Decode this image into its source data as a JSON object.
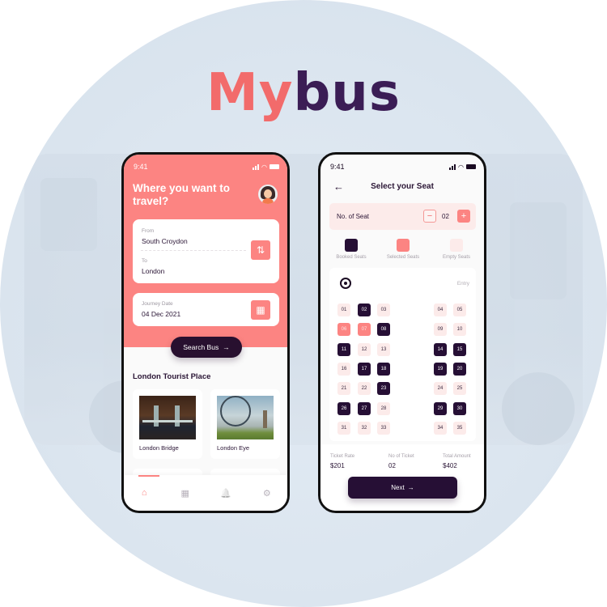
{
  "brand": {
    "logo_part1": "My",
    "logo_part2": "bus",
    "accent": "#fc8482",
    "dark": "#260f35"
  },
  "home": {
    "status_time": "9:41",
    "title": "Where you want to travel?",
    "from_label": "From",
    "from_value": "South Croydon",
    "to_label": "To",
    "to_value": "London",
    "swap_icon": "swap-vertical-icon",
    "date_label": "Journey Date",
    "date_value": "04 Dec 2021",
    "calendar_icon": "calendar-icon",
    "search_button": "Search Bus",
    "search_arrow": "→",
    "section_title": "London Tourist Place",
    "places": [
      {
        "name": "London Bridge"
      },
      {
        "name": "London Eye"
      }
    ],
    "tabs": [
      {
        "icon": "home-icon",
        "glyph": "⌂",
        "active": true
      },
      {
        "icon": "grid-icon",
        "glyph": "▦",
        "active": false
      },
      {
        "icon": "bell-icon",
        "glyph": "🔔",
        "active": false
      },
      {
        "icon": "gear-icon",
        "glyph": "⚙",
        "active": false
      }
    ]
  },
  "seat": {
    "status_time": "9:41",
    "back_arrow": "←",
    "title": "Select your Seat",
    "count_label": "No. of Seat",
    "count_value": "02",
    "minus": "−",
    "plus": "+",
    "legend": [
      {
        "label": "Booked Seats",
        "state": "booked"
      },
      {
        "label": "Selected Seats",
        "state": "selected"
      },
      {
        "label": "Empty Seats",
        "state": "empty"
      }
    ],
    "entry_label": "Entry",
    "rows": [
      [
        [
          "01",
          "empty"
        ],
        [
          "02",
          "booked"
        ],
        [
          "03",
          "empty"
        ],
        [
          "04",
          "empty"
        ],
        [
          "05",
          "empty"
        ]
      ],
      [
        [
          "06",
          "selected"
        ],
        [
          "07",
          "selected"
        ],
        [
          "08",
          "booked"
        ],
        [
          "09",
          "empty"
        ],
        [
          "10",
          "empty"
        ]
      ],
      [
        [
          "11",
          "booked"
        ],
        [
          "12",
          "empty"
        ],
        [
          "13",
          "empty"
        ],
        [
          "14",
          "booked"
        ],
        [
          "15",
          "booked"
        ]
      ],
      [
        [
          "16",
          "empty"
        ],
        [
          "17",
          "booked"
        ],
        [
          "18",
          "booked"
        ],
        [
          "19",
          "booked"
        ],
        [
          "20",
          "booked"
        ]
      ],
      [
        [
          "21",
          "empty"
        ],
        [
          "22",
          "empty"
        ],
        [
          "23",
          "booked"
        ],
        [
          "24",
          "empty"
        ],
        [
          "25",
          "empty"
        ]
      ],
      [
        [
          "26",
          "booked"
        ],
        [
          "27",
          "booked"
        ],
        [
          "28",
          "empty"
        ],
        [
          "29",
          "booked"
        ],
        [
          "30",
          "booked"
        ]
      ],
      [
        [
          "31",
          "empty"
        ],
        [
          "32",
          "empty"
        ],
        [
          "33",
          "empty"
        ],
        [
          "34",
          "empty"
        ],
        [
          "35",
          "empty"
        ]
      ],
      [
        [
          "",
          "booked"
        ],
        [
          "",
          "empty"
        ],
        [
          "",
          "booked"
        ],
        [
          "",
          "booked"
        ],
        [
          "",
          "booked"
        ]
      ]
    ],
    "ticket_rate_label": "Ticket Rate",
    "ticket_rate": "$201",
    "ticket_count_label": "No of Ticket",
    "ticket_count": "02",
    "total_label": "Total Amount",
    "total": "$402",
    "next_button": "Next",
    "next_arrow": "→"
  }
}
